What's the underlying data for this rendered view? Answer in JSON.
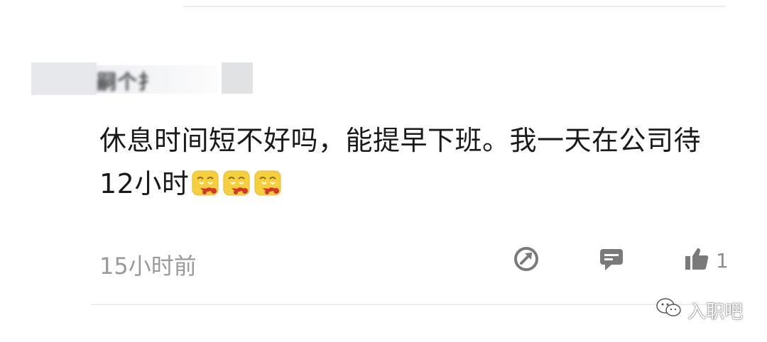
{
  "comment": {
    "username": "嗣个扌",
    "text_line1": "休息时间短不好吗，能提早下班。我一天在公司待",
    "text_line2": "12小时",
    "emojis": [
      "smiling-eyes-nosebleed-emoji",
      "smiling-eyes-nosebleed-emoji",
      "smiling-eyes-nosebleed-emoji"
    ],
    "timestamp": "15小时前"
  },
  "actions": {
    "share_icon": "share-icon",
    "reply_icon": "comment-icon",
    "like_icon": "thumbs-up-icon",
    "like_count": "1"
  },
  "watermark": {
    "icon": "wechat-icon",
    "label": "入职吧"
  },
  "colors": {
    "text": "#1a1a1a",
    "muted": "#9a9a9a",
    "icon": "#7a7a7a"
  }
}
